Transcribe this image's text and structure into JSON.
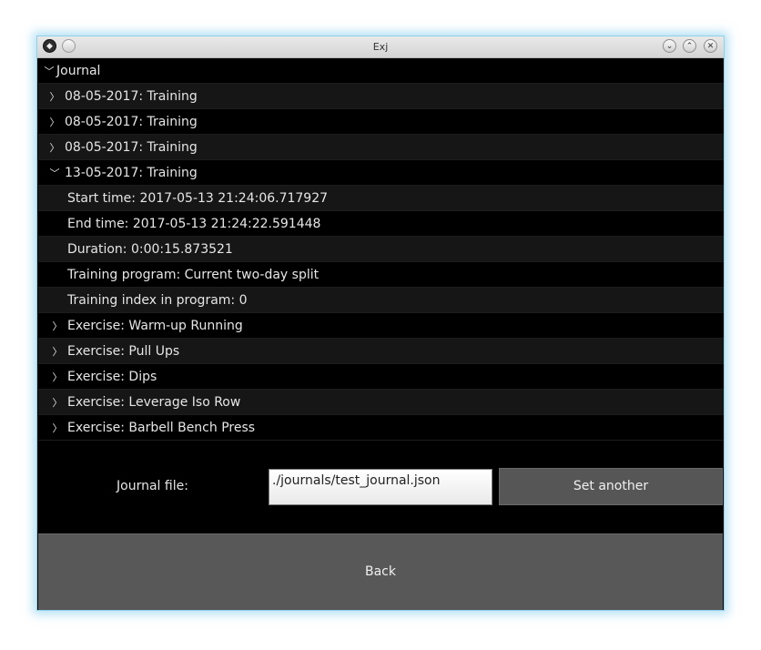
{
  "window": {
    "title": "Exj"
  },
  "tree": {
    "root": {
      "label": "Journal",
      "expanded": true
    },
    "entries": [
      {
        "label": "08-05-2017: Training",
        "expanded": false
      },
      {
        "label": "08-05-2017: Training",
        "expanded": false
      },
      {
        "label": "08-05-2017: Training",
        "expanded": false
      },
      {
        "label": "13-05-2017: Training",
        "expanded": true
      }
    ],
    "details": [
      "Start time: 2017-05-13 21:24:06.717927",
      "End time: 2017-05-13 21:24:22.591448",
      "Duration: 0:00:15.873521",
      "Training program: Current two-day split",
      "Training index in program: 0"
    ],
    "exercises": [
      "Exercise: Warm-up Running",
      "Exercise: Pull Ups",
      "Exercise: Dips",
      "Exercise: Leverage Iso Row",
      "Exercise: Barbell Bench Press"
    ]
  },
  "journal_file": {
    "label": "Journal file:",
    "value": "./journals/test_journal.json",
    "set_another_label": "Set another"
  },
  "back_label": "Back",
  "icons": {
    "collapsed": "chevron-right-icon",
    "expanded": "chevron-down-icon"
  }
}
